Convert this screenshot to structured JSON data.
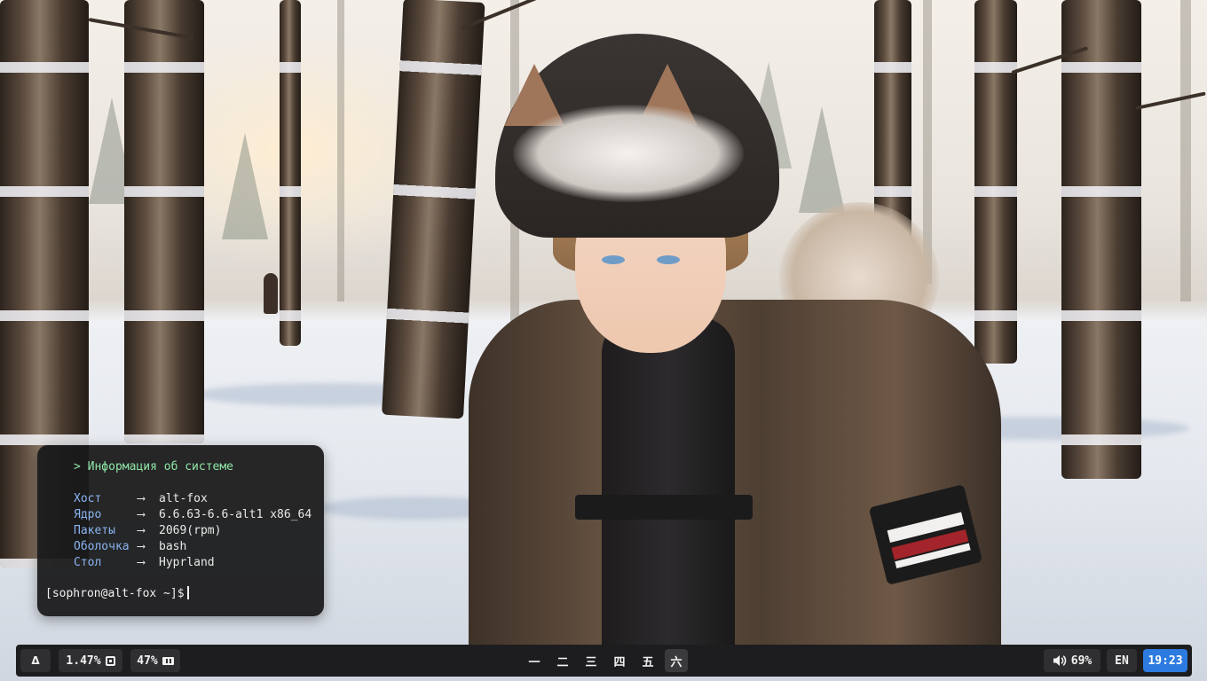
{
  "terminal": {
    "header": "> Информация об системе",
    "rows": [
      {
        "key": "Хост",
        "arrow": "⟶",
        "value": "alt-fox"
      },
      {
        "key": "Ядро",
        "arrow": "⟶",
        "value": "6.6.63-6.6-alt1 x86_64"
      },
      {
        "key": "Пакеты",
        "arrow": "⟶",
        "value": "2069(rpm)"
      },
      {
        "key": "Оболочка",
        "arrow": "⟶",
        "value": "bash"
      },
      {
        "key": "Стол",
        "arrow": "⟶",
        "value": "Hyprland"
      }
    ],
    "prompt": "[sophron@alt-fox ~]$"
  },
  "bar": {
    "launcher_glyph": "Δ",
    "cpu": {
      "value": "1.47%",
      "icon": "cpu-icon"
    },
    "ram": {
      "value": "47%",
      "icon": "memory-icon"
    },
    "workspaces": [
      {
        "label": "一",
        "active": false
      },
      {
        "label": "二",
        "active": false
      },
      {
        "label": "三",
        "active": false
      },
      {
        "label": "四",
        "active": false
      },
      {
        "label": "五",
        "active": false
      },
      {
        "label": "六",
        "active": true
      }
    ],
    "volume": {
      "value": "69%",
      "icon": "speaker-icon"
    },
    "layout": "EN",
    "clock": "19:23"
  },
  "colors": {
    "bar_bg": "#1d1d1f",
    "pill_bg": "#2f2f32",
    "clock_accent": "#2d7be0",
    "terminal_header": "#8fe6a6",
    "terminal_key": "#8ab4f0"
  }
}
